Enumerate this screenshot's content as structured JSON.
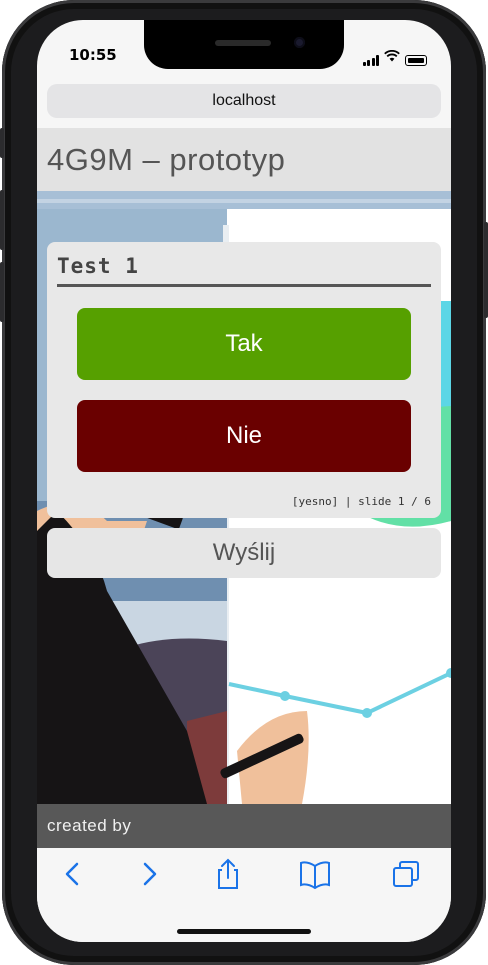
{
  "status_bar": {
    "time": "10:55",
    "icons": [
      "signal-icon",
      "wifi-icon",
      "battery-icon"
    ]
  },
  "browser": {
    "url": "localhost"
  },
  "page": {
    "title": "4G9M – prototyp",
    "card": {
      "title": "Test 1",
      "yes_label": "Tak",
      "no_label": "Nie",
      "meta": "[yesno] | slide 1 / 6"
    },
    "send_label": "Wyślij",
    "footer": "created by"
  },
  "toolbar": {
    "icons": [
      "back-icon",
      "forward-icon",
      "share-icon",
      "bookmarks-icon",
      "tabs-icon"
    ],
    "accent": "#1a73e8"
  },
  "colors": {
    "yes": "#56a000",
    "no": "#6a0000",
    "header_bg": "#e2e2e2",
    "footer_bg": "#585858"
  }
}
